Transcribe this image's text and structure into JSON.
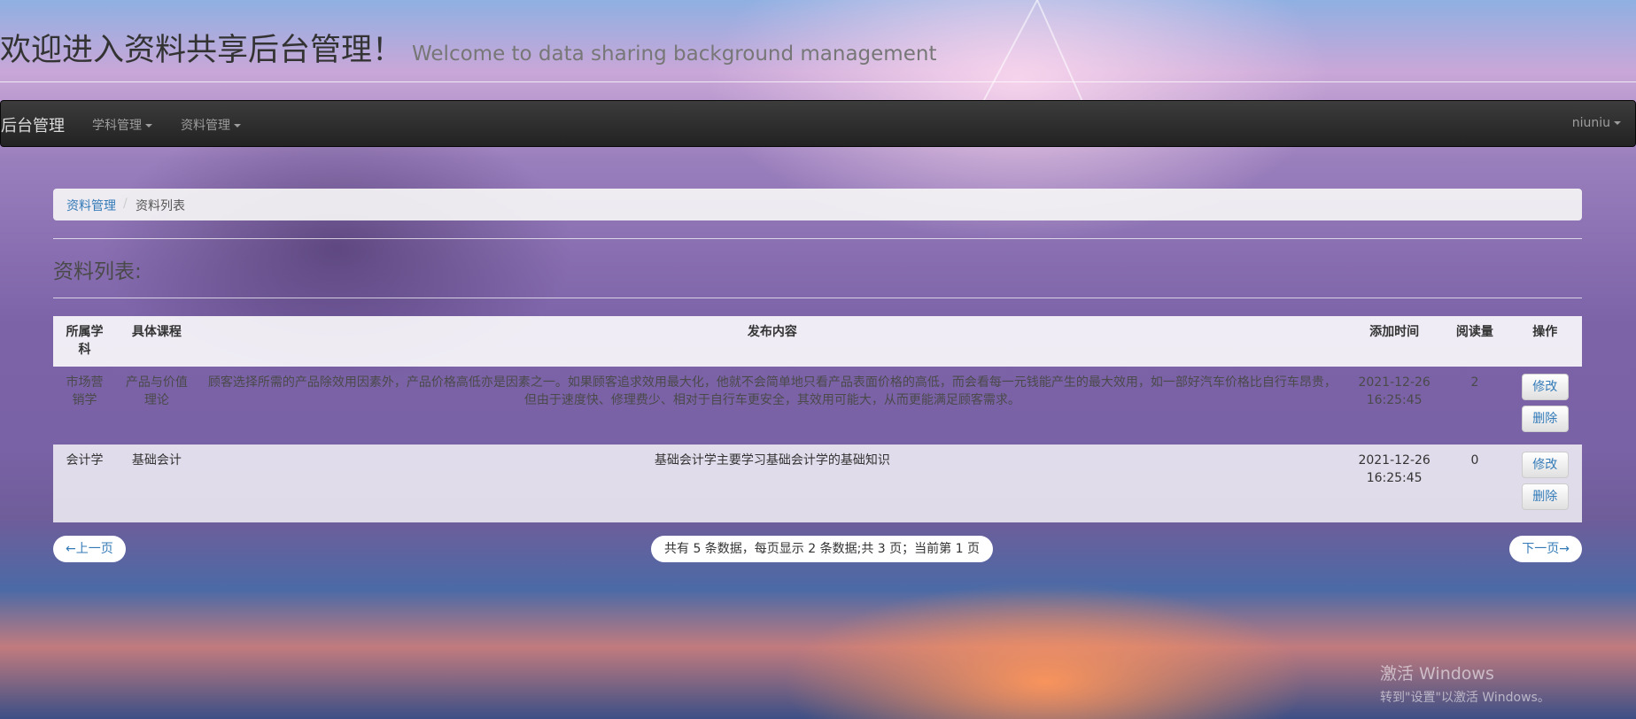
{
  "header": {
    "title": "欢迎进入资料共享后台管理！",
    "subtitle": "Welcome to data sharing background management"
  },
  "navbar": {
    "brand": "后台管理",
    "menus": [
      {
        "label": "学科管理"
      },
      {
        "label": "资料管理"
      }
    ],
    "user": "niuniu"
  },
  "breadcrumb": {
    "parent": "资料管理",
    "separator": "/",
    "current": "资料列表"
  },
  "section": {
    "title": "资料列表:"
  },
  "table": {
    "columns": [
      "所属学科",
      "具体课程",
      "发布内容",
      "添加时间",
      "阅读量",
      "操作"
    ],
    "rows": [
      {
        "subject": "市场营销学",
        "course": "产品与价值理论",
        "content": "顾客选择所需的产品除效用因素外，产品价格高低亦是因素之一。如果顾客追求效用最大化，他就不会简单地只看产品表面价格的高低，而会看每一元钱能产生的最大效用，如一部好汽车价格比自行车昂贵，但由于速度快、修理费少、相对于自行车更安全，其效用可能大，从而更能满足顾客需求。",
        "time": "2021-12-26 16:25:45",
        "reads": "2",
        "edit_label": "修改",
        "delete_label": "删除"
      },
      {
        "subject": "会计学",
        "course": "基础会计",
        "content": "基础会计学主要学习基础会计学的基础知识",
        "time": "2021-12-26 16:25:45",
        "reads": "0",
        "edit_label": "修改",
        "delete_label": "删除"
      }
    ]
  },
  "pager": {
    "prev": "←上一页",
    "info": "共有 5 条数据，每页显示 2 条数据;共 3 页；当前第 1 页",
    "next": "下一页→"
  },
  "watermark": {
    "title": "激活 Windows",
    "subtitle": "转到\"设置\"以激活 Windows。"
  },
  "colors": {
    "link": "#337ab7",
    "navbar": "#222222"
  },
  "icons": {
    "dropdown": "caret-down-icon"
  }
}
